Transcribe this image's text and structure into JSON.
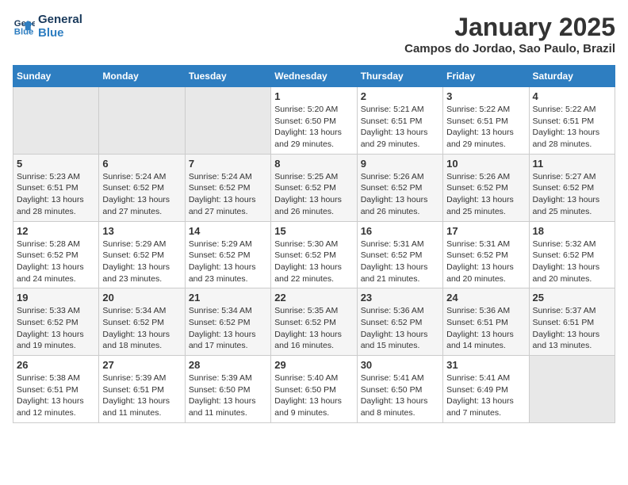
{
  "logo": {
    "line1": "General",
    "line2": "Blue"
  },
  "title": "January 2025",
  "location": "Campos do Jordao, Sao Paulo, Brazil",
  "days_of_week": [
    "Sunday",
    "Monday",
    "Tuesday",
    "Wednesday",
    "Thursday",
    "Friday",
    "Saturday"
  ],
  "weeks": [
    [
      {
        "day": "",
        "info": ""
      },
      {
        "day": "",
        "info": ""
      },
      {
        "day": "",
        "info": ""
      },
      {
        "day": "1",
        "info": "Sunrise: 5:20 AM\nSunset: 6:50 PM\nDaylight: 13 hours\nand 29 minutes."
      },
      {
        "day": "2",
        "info": "Sunrise: 5:21 AM\nSunset: 6:51 PM\nDaylight: 13 hours\nand 29 minutes."
      },
      {
        "day": "3",
        "info": "Sunrise: 5:22 AM\nSunset: 6:51 PM\nDaylight: 13 hours\nand 29 minutes."
      },
      {
        "day": "4",
        "info": "Sunrise: 5:22 AM\nSunset: 6:51 PM\nDaylight: 13 hours\nand 28 minutes."
      }
    ],
    [
      {
        "day": "5",
        "info": "Sunrise: 5:23 AM\nSunset: 6:51 PM\nDaylight: 13 hours\nand 28 minutes."
      },
      {
        "day": "6",
        "info": "Sunrise: 5:24 AM\nSunset: 6:52 PM\nDaylight: 13 hours\nand 27 minutes."
      },
      {
        "day": "7",
        "info": "Sunrise: 5:24 AM\nSunset: 6:52 PM\nDaylight: 13 hours\nand 27 minutes."
      },
      {
        "day": "8",
        "info": "Sunrise: 5:25 AM\nSunset: 6:52 PM\nDaylight: 13 hours\nand 26 minutes."
      },
      {
        "day": "9",
        "info": "Sunrise: 5:26 AM\nSunset: 6:52 PM\nDaylight: 13 hours\nand 26 minutes."
      },
      {
        "day": "10",
        "info": "Sunrise: 5:26 AM\nSunset: 6:52 PM\nDaylight: 13 hours\nand 25 minutes."
      },
      {
        "day": "11",
        "info": "Sunrise: 5:27 AM\nSunset: 6:52 PM\nDaylight: 13 hours\nand 25 minutes."
      }
    ],
    [
      {
        "day": "12",
        "info": "Sunrise: 5:28 AM\nSunset: 6:52 PM\nDaylight: 13 hours\nand 24 minutes."
      },
      {
        "day": "13",
        "info": "Sunrise: 5:29 AM\nSunset: 6:52 PM\nDaylight: 13 hours\nand 23 minutes."
      },
      {
        "day": "14",
        "info": "Sunrise: 5:29 AM\nSunset: 6:52 PM\nDaylight: 13 hours\nand 23 minutes."
      },
      {
        "day": "15",
        "info": "Sunrise: 5:30 AM\nSunset: 6:52 PM\nDaylight: 13 hours\nand 22 minutes."
      },
      {
        "day": "16",
        "info": "Sunrise: 5:31 AM\nSunset: 6:52 PM\nDaylight: 13 hours\nand 21 minutes."
      },
      {
        "day": "17",
        "info": "Sunrise: 5:31 AM\nSunset: 6:52 PM\nDaylight: 13 hours\nand 20 minutes."
      },
      {
        "day": "18",
        "info": "Sunrise: 5:32 AM\nSunset: 6:52 PM\nDaylight: 13 hours\nand 20 minutes."
      }
    ],
    [
      {
        "day": "19",
        "info": "Sunrise: 5:33 AM\nSunset: 6:52 PM\nDaylight: 13 hours\nand 19 minutes."
      },
      {
        "day": "20",
        "info": "Sunrise: 5:34 AM\nSunset: 6:52 PM\nDaylight: 13 hours\nand 18 minutes."
      },
      {
        "day": "21",
        "info": "Sunrise: 5:34 AM\nSunset: 6:52 PM\nDaylight: 13 hours\nand 17 minutes."
      },
      {
        "day": "22",
        "info": "Sunrise: 5:35 AM\nSunset: 6:52 PM\nDaylight: 13 hours\nand 16 minutes."
      },
      {
        "day": "23",
        "info": "Sunrise: 5:36 AM\nSunset: 6:52 PM\nDaylight: 13 hours\nand 15 minutes."
      },
      {
        "day": "24",
        "info": "Sunrise: 5:36 AM\nSunset: 6:51 PM\nDaylight: 13 hours\nand 14 minutes."
      },
      {
        "day": "25",
        "info": "Sunrise: 5:37 AM\nSunset: 6:51 PM\nDaylight: 13 hours\nand 13 minutes."
      }
    ],
    [
      {
        "day": "26",
        "info": "Sunrise: 5:38 AM\nSunset: 6:51 PM\nDaylight: 13 hours\nand 12 minutes."
      },
      {
        "day": "27",
        "info": "Sunrise: 5:39 AM\nSunset: 6:51 PM\nDaylight: 13 hours\nand 11 minutes."
      },
      {
        "day": "28",
        "info": "Sunrise: 5:39 AM\nSunset: 6:50 PM\nDaylight: 13 hours\nand 11 minutes."
      },
      {
        "day": "29",
        "info": "Sunrise: 5:40 AM\nSunset: 6:50 PM\nDaylight: 13 hours\nand 9 minutes."
      },
      {
        "day": "30",
        "info": "Sunrise: 5:41 AM\nSunset: 6:50 PM\nDaylight: 13 hours\nand 8 minutes."
      },
      {
        "day": "31",
        "info": "Sunrise: 5:41 AM\nSunset: 6:49 PM\nDaylight: 13 hours\nand 7 minutes."
      },
      {
        "day": "",
        "info": ""
      }
    ]
  ]
}
